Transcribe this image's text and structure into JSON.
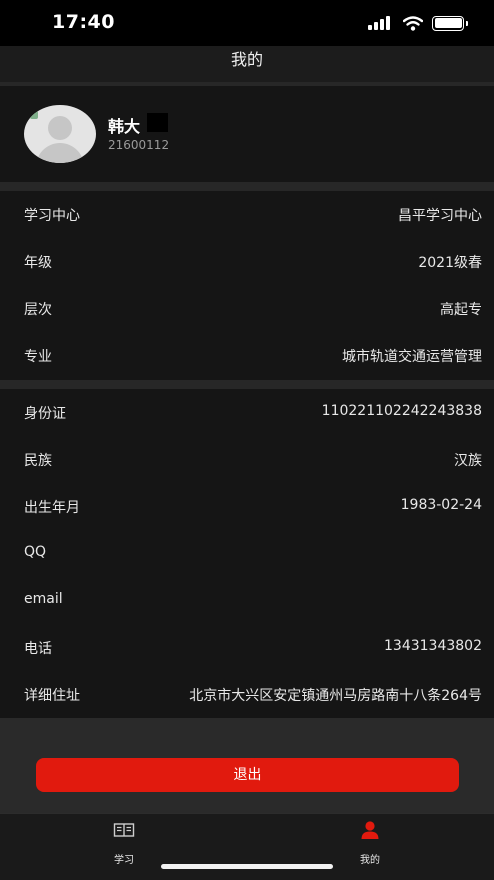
{
  "status_bar": {
    "time": "17:40"
  },
  "header": {
    "title": "我的"
  },
  "profile": {
    "name": "韩大",
    "student_id": "21600112"
  },
  "study_info": [
    {
      "label": "学习中心",
      "value": "昌平学习中心"
    },
    {
      "label": "年级",
      "value": "2021级春"
    },
    {
      "label": "层次",
      "value": "高起专"
    },
    {
      "label": "专业",
      "value": "城市轨道交通运营管理"
    }
  ],
  "personal_info": [
    {
      "label": "身份证",
      "value": "110221102242243838"
    },
    {
      "label": "民族",
      "value": "汉族"
    },
    {
      "label": "出生年月",
      "value": "1983-02-24"
    },
    {
      "label": "QQ",
      "value": ""
    },
    {
      "label": "email",
      "value": ""
    },
    {
      "label": "电话",
      "value": "13431343802"
    },
    {
      "label": "详细住址",
      "value": "北京市大兴区安定镇通州马房路南十八条264号"
    }
  ],
  "actions": {
    "logout_label": "退出"
  },
  "tab_bar": {
    "tabs": [
      {
        "label": "学习",
        "icon": "book-icon",
        "active": false
      },
      {
        "label": "我的",
        "icon": "person-icon",
        "active": true
      }
    ],
    "active_color": "#e11a0e"
  },
  "colors": {
    "accent": "#e11a0e",
    "background": "#151515",
    "divider": "#272727"
  }
}
